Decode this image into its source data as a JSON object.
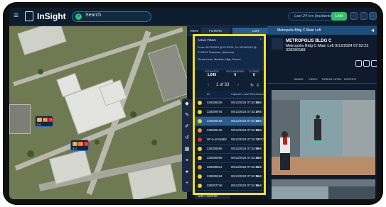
{
  "app": {
    "title": "InSight",
    "search_label": "Search",
    "time_range": "Last 24 hrs (incidents)",
    "live_label": "Live"
  },
  "tabs": {
    "view": "VIEW",
    "filters": "FILTERS",
    "list": "LIST"
  },
  "filters": {
    "header": "Active Filters",
    "line1": "From: 09/13/2024 @ 07:53:31, To: 09/14/2024 @",
    "line2": "07:53:31 Timezone: (America)",
    "line3": "Threat Level: Medium, High, Severe"
  },
  "counts": [
    {
      "label": "ESTIMATED",
      "value": "1,645"
    },
    {
      "label": "UNCLASSIFIED",
      "value": "0"
    },
    {
      "label": "CLOSED",
      "value": "0"
    }
  ],
  "pager": {
    "text": "1 of 33"
  },
  "table_headers": [
    "ID",
    "Capture Local Time",
    "Source"
  ],
  "rows": [
    {
      "id": "328389438",
      "time": "09/13/2024 07:53:53",
      "source": "Metr",
      "color": "#f2d21b"
    },
    {
      "id": "328389784",
      "time": "09/13/2024 07:53:17",
      "source": "Metr",
      "color": "#f2d21b"
    },
    {
      "id": "328389188",
      "time": "09/13/2024 07:52:23",
      "source": "Metr",
      "color": "#f2d21b",
      "selected": true
    },
    {
      "id": "328389150",
      "time": "09/13/2024 07:52:23",
      "source": "Metr",
      "color": "#e89a20"
    },
    {
      "id": "DF-6-1016883",
      "time": "09/13/2024 07:52:42",
      "source": "TARC",
      "color": "#e03030"
    },
    {
      "id": "328389096",
      "time": "09/13/2024 07:53:09",
      "source": "Metr",
      "color": "#f2d21b"
    },
    {
      "id": "328385066",
      "time": "09/13/2024 07:53:46",
      "source": "Metr",
      "color": "#f2d21b"
    },
    {
      "id": "328388814",
      "time": "09/13/2024 07:53:41",
      "source": "Metr",
      "color": "#e89a20"
    },
    {
      "id": "328385284",
      "time": "09/13/2024 07:52:36",
      "source": "Metr",
      "color": "#f2d21b"
    },
    {
      "id": "328387746",
      "time": "09/13/2024 07:52:55",
      "source": "Metr",
      "color": "#f2d21b"
    }
  ],
  "detail": {
    "header": "Metropolis Bldg C Main Left",
    "title": "METROPOLIS BLDG C",
    "subtitle": "Metropolis Bldg C Main Left 9/13/2024 07:52:22 328389188",
    "tabs": [
      "IMAGE",
      "VIDEO",
      "THREAT LEVEL",
      "HISTORY"
    ]
  },
  "map_cards": [
    {
      "chips": [
        "10",
        "44",
        "0"
      ],
      "sub": "3   0"
    },
    {
      "chips": [
        "9",
        "11",
        "0"
      ],
      "sub": "3   0"
    }
  ],
  "site_favorites": "Site Favorite"
}
